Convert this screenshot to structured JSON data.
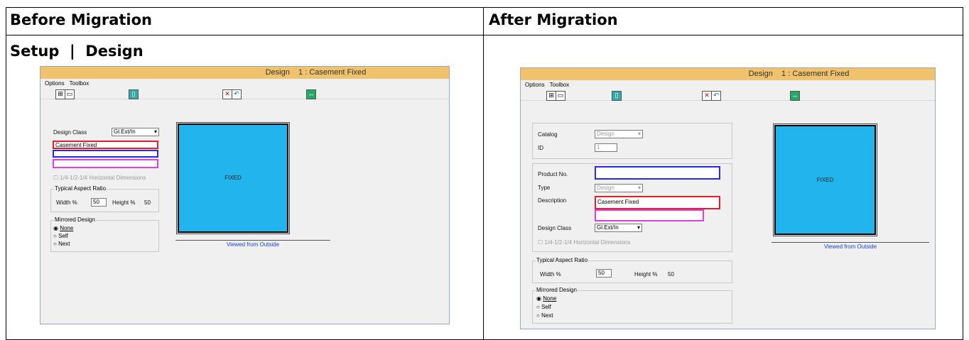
{
  "headers": {
    "before": "Before Migration",
    "after": "After Migration",
    "breadcrumb": "Setup  |  Design"
  },
  "before": {
    "title": "Design    1 : Casement Fixed",
    "menu": [
      "Options",
      "Toolbox"
    ],
    "design_class_label": "Design Class",
    "design_class_value": "Gl.Ext/In",
    "description_value": "Casement Fixed",
    "horiz_dims_label": "1/4-1/2-1/4 Horizontal Dimensions",
    "aspect_title": "Typical Aspect Ratio",
    "width_label": "Width %",
    "width_value": "50",
    "height_label": "Height %",
    "height_value": "50",
    "mirrored_title": "Mirrored Design",
    "radio_none": "None",
    "radio_self": "Self",
    "radio_next": "Next",
    "preview_text": "FIXED",
    "viewed": "Viewed from Outside"
  },
  "after": {
    "title": "Design    1 : Casement Fixed",
    "menu": [
      "Options",
      "Toolbox"
    ],
    "catalog_label": "Catalog",
    "catalog_value": "Design",
    "id_label": "ID",
    "id_value": "1",
    "product_label": "Product No.",
    "type_label": "Type",
    "type_value": "Design",
    "desc_label": "Description",
    "desc_value": "Casement Fixed",
    "design_class_label": "Design Class",
    "design_class_value": "Gl.Ext/In",
    "horiz_dims_label": "1/4-1/2-1/4 Horizontal Dimensions",
    "aspect_title": "Typical Aspect Ratio",
    "width_label": "Width %",
    "width_value": "50",
    "height_label": "Height %",
    "height_value": "50",
    "mirrored_title": "Mirrored Design",
    "radio_none": "None",
    "radio_self": "Self",
    "radio_next": "Next",
    "preview_text": "FIXED",
    "viewed": "Viewed from Outside"
  },
  "colors": {
    "title_bar": "#f1c26d",
    "preview": "#22b4ec",
    "highlight_red": "#e0202a",
    "highlight_blue": "#2a2ae0",
    "highlight_magenta": "#e040e0"
  }
}
